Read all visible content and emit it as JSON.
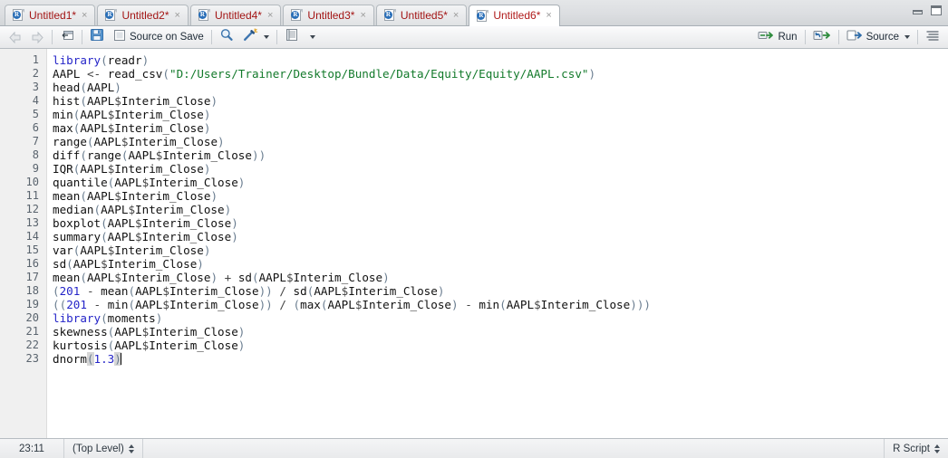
{
  "window": {
    "minimize_icon": "minimize-icon",
    "maximize_icon": "maximize-icon"
  },
  "tabs": [
    {
      "label": "Untitled1*",
      "icon": "r-script-icon",
      "close": "×",
      "active": false
    },
    {
      "label": "Untitled2*",
      "icon": "r-script-icon",
      "close": "×",
      "active": false
    },
    {
      "label": "Untitled4*",
      "icon": "r-script-icon",
      "close": "×",
      "active": false
    },
    {
      "label": "Untitled3*",
      "icon": "r-script-icon",
      "close": "×",
      "active": false
    },
    {
      "label": "Untitled5*",
      "icon": "r-script-icon",
      "close": "×",
      "active": false
    },
    {
      "label": "Untitled6*",
      "icon": "r-script-icon",
      "close": "×",
      "active": true
    }
  ],
  "toolbar": {
    "back_icon": "back-arrow-icon",
    "forward_icon": "forward-arrow-icon",
    "popout_icon": "show-in-new-window-icon",
    "save_icon": "save-icon",
    "source_on_save_label": "Source on Save",
    "source_on_save_checked": false,
    "find_icon": "search-icon",
    "code_tools_icon": "magic-wand-icon",
    "code_tools_caret": "chevron-down-icon",
    "compile_report_icon": "notebook-icon",
    "compile_report_caret": "chevron-down-icon",
    "run_label": "Run",
    "run_icon": "run-icon",
    "rerun_icon": "rerun-icon",
    "source_label": "Source",
    "source_icon": "source-icon",
    "source_caret": "chevron-down-icon",
    "outline_icon": "document-outline-icon"
  },
  "editor": {
    "line_numbers": [
      "1",
      "2",
      "3",
      "4",
      "5",
      "6",
      "7",
      "8",
      "9",
      "10",
      "11",
      "12",
      "13",
      "14",
      "15",
      "16",
      "17",
      "18",
      "19",
      "20",
      "21",
      "22",
      "23"
    ],
    "lines": [
      "library(readr)",
      "AAPL <- read_csv(\"D:/Users/Trainer/Desktop/Bundle/Data/Equity/Equity/AAPL.csv\")",
      "head(AAPL)",
      "hist(AAPL$Interim_Close)",
      "min(AAPL$Interim_Close)",
      "max(AAPL$Interim_Close)",
      "range(AAPL$Interim_Close)",
      "diff(range(AAPL$Interim_Close))",
      "IQR(AAPL$Interim_Close)",
      "quantile(AAPL$Interim_Close)",
      "mean(AAPL$Interim_Close)",
      "median(AAPL$Interim_Close)",
      "boxplot(AAPL$Interim_Close)",
      "summary(AAPL$Interim_Close)",
      "var(AAPL$Interim_Close)",
      "sd(AAPL$Interim_Close)",
      "mean(AAPL$Interim_Close) + sd(AAPL$Interim_Close)",
      "(201 - mean(AAPL$Interim_Close)) / sd(AAPL$Interim_Close)",
      "((201 - min(AAPL$Interim_Close)) / (max(AAPL$Interim_Close) - min(AAPL$Interim_Close)))",
      "library(moments)",
      "skewness(AAPL$Interim_Close)",
      "kurtosis(AAPL$Interim_Close)",
      "dnorm(1.3)"
    ],
    "file_path_string": "D:/Users/Trainer/Desktop/Bundle/Data/Equity/Equity/AAPL.csv"
  },
  "statusbar": {
    "cursor_position": "23:11",
    "scope": "(Top Level)",
    "file_type": "R Script"
  },
  "colors": {
    "keyword": "#2424c8",
    "string": "#137a2b",
    "number": "#2424c8",
    "paren": "#6a7d90",
    "tab_text": "#a31515",
    "gutter_bg": "#f0f0f0",
    "editor_bg": "#ffffff"
  }
}
